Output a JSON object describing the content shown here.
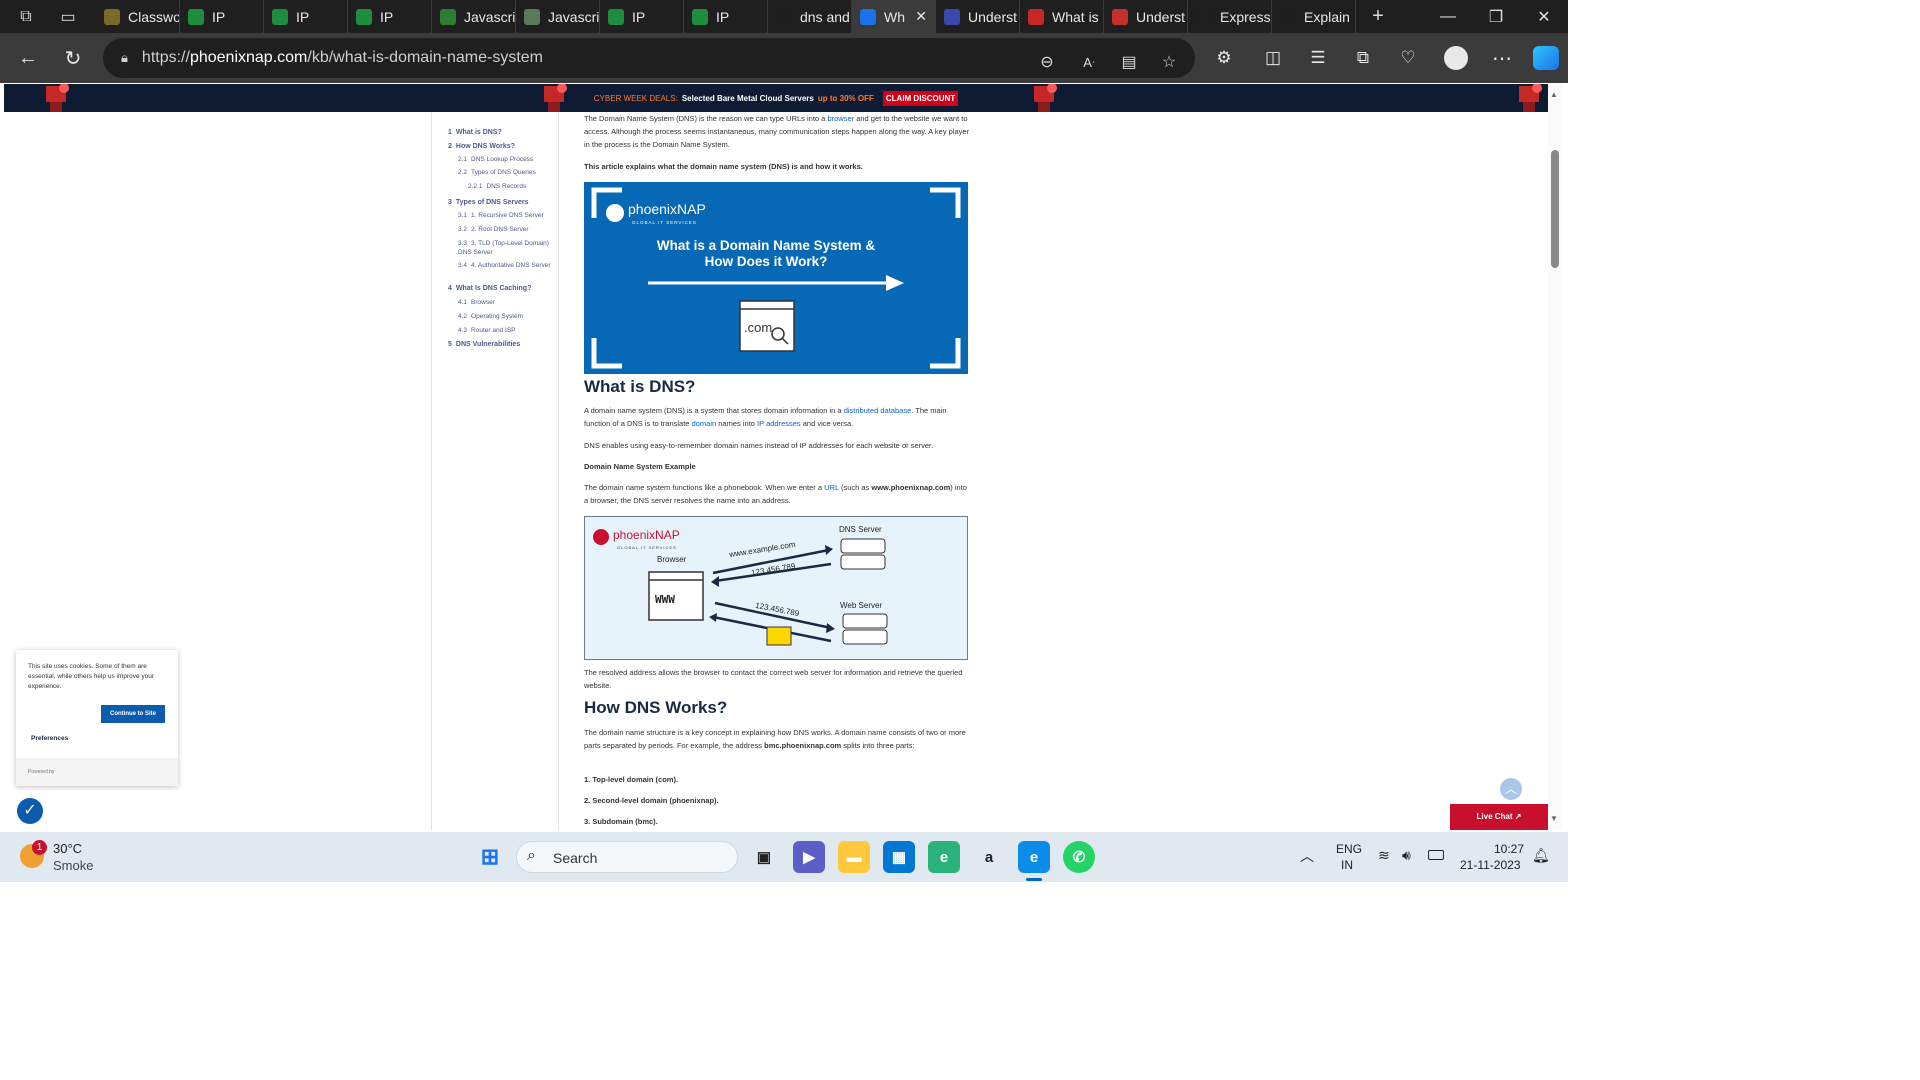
{
  "browser": {
    "tabs": [
      {
        "title": "Classwo",
        "color": "#7a6a2a"
      },
      {
        "title": "IP",
        "color": "#1e8e3e"
      },
      {
        "title": "IP",
        "color": "#1e8e3e"
      },
      {
        "title": "IP",
        "color": "#1e8e3e"
      },
      {
        "title": "Javascrip",
        "color": "#2e7d32"
      },
      {
        "title": "Javascrip",
        "color": "#5a7a5a"
      },
      {
        "title": "IP",
        "color": "#1e8e3e"
      },
      {
        "title": "IP",
        "color": "#1e8e3e"
      },
      {
        "title": "dns and",
        "color": "#1f1f1f"
      },
      {
        "title": "Wh",
        "color": "#1a73e8"
      },
      {
        "title": "Underst",
        "color": "#3949ab"
      },
      {
        "title": "What is",
        "color": "#c62828"
      },
      {
        "title": "Underst",
        "color": "#c4302b"
      },
      {
        "title": "Express.j",
        "color": "#1f1f1f"
      },
      {
        "title": "Explain :",
        "color": "#1f1f1f"
      }
    ],
    "url_prefix": "https://",
    "url_domain": "phoenixnap.com",
    "url_path": "/kb/what-is-domain-name-system"
  },
  "promo": {
    "label": "CYBER WEEK DEALS:",
    "text": "Selected Bare Metal Cloud Servers",
    "offer": "up to 30% OFF",
    "button": "CLAIM DISCOUNT"
  },
  "toc": {
    "items": [
      {
        "num": "1",
        "label": "What is DNS?"
      },
      {
        "num": "2",
        "label": "How DNS Works?"
      },
      {
        "num": "2.1",
        "label": "DNS Lookup Process"
      },
      {
        "num": "2.2",
        "label": "Types of DNS Queries"
      },
      {
        "num": "2.2.1",
        "label": "DNS Records"
      },
      {
        "num": "3",
        "label": "Types of DNS Servers"
      },
      {
        "num": "3.1",
        "label": "1. Recursive DNS Server"
      },
      {
        "num": "3.2",
        "label": "2. Root DNS Server"
      },
      {
        "num": "3.3",
        "label": "3. TLD (Top-Level Domain) DNS Server"
      },
      {
        "num": "3.4",
        "label": "4. Authoritative DNS Server"
      },
      {
        "num": "4",
        "label": "What Is DNS Caching?"
      },
      {
        "num": "4.1",
        "label": "Browser"
      },
      {
        "num": "4.2",
        "label": "Operating System"
      },
      {
        "num": "4.3",
        "label": "Router and ISP"
      },
      {
        "num": "5",
        "label": "DNS Vulnerabilities"
      }
    ]
  },
  "article": {
    "intro_1": "The Domain Name System (DNS) is the reason we can type URLs into a ",
    "intro_link": "browser",
    "intro_2": " and get to the website we want to access. Although the process seems instantaneous, many communication steps happen along the way. A key player in the process is the Domain Name System.",
    "explains": "This article explains what the domain name system (DNS) is and how it works.",
    "hero_brand": "phoenixNAP",
    "hero_brand_sub": "GLOBAL IT SERVICES",
    "hero_title": "What is a Domain Name System & How Does it Work?",
    "hero_com": ".com",
    "h2_what": "What is DNS?",
    "what_1": "A domain name system (DNS) is a system that stores domain information in a ",
    "what_link1": "distributed database",
    "what_2": ". The main function of a DNS is to translate ",
    "what_link2": "domain",
    "what_3": " names into ",
    "what_link3": "IP addresses",
    "what_4": " and vice versa.",
    "enables": "DNS enables using easy-to-remember domain names instead of IP addresses for each website or server.",
    "example_heading": "Domain Name System Example",
    "pb_1": "The domain name system functions like a phonebook. When we enter a ",
    "pb_link": "URL",
    "pb_2": " (such as ",
    "pb_bold": "www.phoenixnap.com",
    "pb_3": ") into a browser, the DNS server resolves the name into an address.",
    "diag_brand": "phoenixNAP",
    "diag_brand_sub": "GLOBAL IT SERVICES",
    "diag_dns": "DNS Server",
    "diag_browser": "Browser",
    "diag_web": "Web Server",
    "diag_url": "www.example.com",
    "diag_ip1": "123.456.789",
    "diag_ip2": "123.456.789",
    "diag_www": "WWW",
    "resolved": "The resolved address allows the browser to contact the correct web server for information and retrieve the queried website.",
    "h2_how": "How DNS Works?",
    "how_1": "The domain name structure is a key concept in explaining how DNS works. A domain name consists of two or more parts separated by periods. For example, the address ",
    "how_bold": "bmc.phoenixnap.com",
    "how_2": " splits into three parts:",
    "list1": "1. Top-level domain (com).",
    "list2": "2. Second-level domain (phoenixnap).",
    "list3": "3. Subdomain (bmc)."
  },
  "cookie": {
    "text": "This site uses cookies. Some of them are essential, while others help us improve your experience.",
    "button": "Continue to Site",
    "prefs": "Preferences",
    "powered": "Powered by"
  },
  "livechat": "Live Chat ↗",
  "taskbar": {
    "weather_temp": "30°C",
    "weather_desc": "Smoke",
    "weather_badge": "1",
    "search": "Search",
    "lang1": "ENG",
    "lang2": "IN",
    "time": "10:27",
    "date": "21-11-2023"
  }
}
